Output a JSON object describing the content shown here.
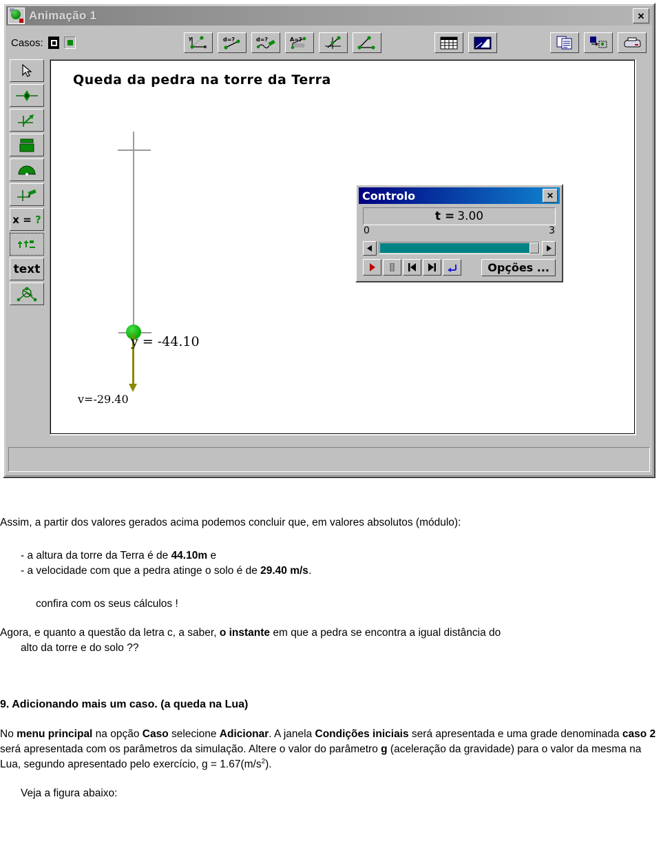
{
  "window": {
    "title": "Animação 1",
    "icon": "animation-globe-icon",
    "close_label": "✕"
  },
  "toolbar": {
    "casos_label": "Casos:",
    "case_buttons": [
      {
        "name": "case-selected",
        "state": "selected"
      },
      {
        "name": "case-1",
        "state": "normal"
      }
    ],
    "buttons": [
      {
        "name": "axes-tool",
        "title": "Eixos x y"
      },
      {
        "name": "distance-tool",
        "title": "d=?"
      },
      {
        "name": "path-length-tool",
        "title": "d=?"
      },
      {
        "name": "area-tool",
        "title": "A=?"
      },
      {
        "name": "slope-tool",
        "title": "Declive"
      },
      {
        "name": "angle-tool",
        "title": "Ângulo"
      },
      {
        "name": "table-tool",
        "title": "Tabela"
      },
      {
        "name": "graph-tool",
        "title": "Gráfico"
      },
      {
        "name": "copy-tool",
        "title": "Copiar"
      },
      {
        "name": "export-tool",
        "title": "Exportar"
      },
      {
        "name": "print-tool",
        "title": "Imprimir"
      }
    ]
  },
  "palette": {
    "items": [
      {
        "name": "select-pointer-tool",
        "label": ""
      },
      {
        "name": "point-tool",
        "label": ""
      },
      {
        "name": "vector-tool",
        "label": ""
      },
      {
        "name": "box-tool",
        "label": ""
      },
      {
        "name": "protractor-tool",
        "label": ""
      },
      {
        "name": "ruler-pencil-tool",
        "label": ""
      },
      {
        "name": "equation-tool",
        "label": "x = ?"
      },
      {
        "name": "selection-frame-tool",
        "label": ""
      },
      {
        "name": "text-tool",
        "label": "text"
      },
      {
        "name": "object-tool",
        "label": ""
      }
    ]
  },
  "canvas": {
    "title": "Queda da pedra na torre da Terra",
    "position_label": "y = -44.10",
    "velocity_label": "v=-29.40"
  },
  "dialog": {
    "title": "Controlo",
    "close_label": "✕",
    "readout_var": "t =",
    "readout_value": "3.00",
    "range_min": "0",
    "range_max": "3",
    "options_label": "Opções ...",
    "buttons": [
      {
        "name": "play-button"
      },
      {
        "name": "pause-button"
      },
      {
        "name": "step-back-button"
      },
      {
        "name": "step-forward-button"
      },
      {
        "name": "reset-button"
      }
    ],
    "slider": {
      "value": 3,
      "min": 0,
      "max": 3
    }
  },
  "doc": {
    "intro": "Assim, a partir dos valores gerados acima podemos concluir que, em valores absolutos (módulo):",
    "bullet1_a": "- a altura da torre da Terra é de ",
    "bullet1_b": "44.10m",
    "bullet1_c": " e",
    "bullet2_a": "- a velocidade com que a pedra atinge o solo é de ",
    "bullet2_b": "29.40 m/s",
    "bullet2_c": ".",
    "confira": "confira com os seus cálculos !",
    "agora_a": "Agora, e quanto a questão da letra c, a saber, ",
    "agora_b": "o instante",
    "agora_c": " em que a pedra se encontra a igual distância do",
    "agora_d": "alto da torre e do solo ??",
    "heading9": "9. Adicionando mais um caso. (a queda na Lua)",
    "para_a": "No ",
    "para_b": "menu principal",
    "para_c": " na opção ",
    "para_d": "Caso",
    "para_e": " selecione ",
    "para_f": "Adicionar",
    "para_g": ". A janela ",
    "para_h": "Condições iniciais",
    "para_i": " será apresentada",
    "para_j": "e uma grade denominada ",
    "para_k": "caso 2",
    "para_l": " será apresentada com os parâmetros da simulação. Altere o valor",
    "para_m": "do parâmetro ",
    "para_n": "g",
    "para_o": " (aceleração da gravidade) para o valor da mesma na Lua, segundo apresentado pelo",
    "para_p": "exercício, g = 1.67(m/s",
    "para_q": "2",
    "para_r": ").",
    "veja": "Veja a figura abaixo:"
  }
}
